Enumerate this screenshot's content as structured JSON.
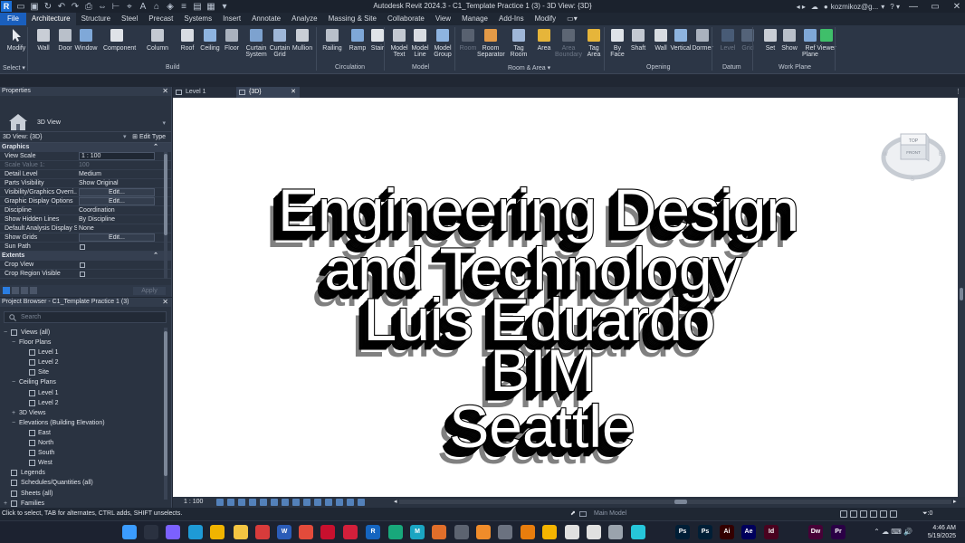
{
  "title_bar": {
    "app_title": "Autodesk Revit 2024.3 - C1_Template Practice 1 (3) - 3D View: {3D}",
    "user": "kozmikoz@g...",
    "help": "?"
  },
  "ribbon_tabs": [
    "File",
    "Architecture",
    "Structure",
    "Steel",
    "Precast",
    "Systems",
    "Insert",
    "Annotate",
    "Analyze",
    "Massing & Site",
    "Collaborate",
    "View",
    "Manage",
    "Add-Ins",
    "Modify"
  ],
  "active_tab": "Architecture",
  "ribbon": {
    "select_label": "Select",
    "tools": [
      {
        "label": "Modify",
        "icon": "modify-cursor-icon"
      },
      {
        "label": "Wall",
        "icon": "wall-icon"
      },
      {
        "label": "Door",
        "icon": "door-icon"
      },
      {
        "label": "Window",
        "icon": "window-icon"
      },
      {
        "label": "Component",
        "icon": "component-icon"
      },
      {
        "label": "Column",
        "icon": "column-icon"
      },
      {
        "label": "Roof",
        "icon": "roof-icon"
      },
      {
        "label": "Ceiling",
        "icon": "ceiling-icon"
      },
      {
        "label": "Floor",
        "icon": "floor-icon"
      },
      {
        "label": "Curtain\nSystem",
        "icon": "curtain-system-icon"
      },
      {
        "label": "Curtain\nGrid",
        "icon": "curtain-grid-icon"
      },
      {
        "label": "Mullion",
        "icon": "mullion-icon"
      },
      {
        "label": "Railing",
        "icon": "railing-icon"
      },
      {
        "label": "Ramp",
        "icon": "ramp-icon"
      },
      {
        "label": "Stair",
        "icon": "stair-icon"
      },
      {
        "label": "Model\nText",
        "icon": "model-text-icon"
      },
      {
        "label": "Model\nLine",
        "icon": "model-line-icon"
      },
      {
        "label": "Model\nGroup",
        "icon": "model-group-icon"
      },
      {
        "label": "Room",
        "icon": "room-icon"
      },
      {
        "label": "Room\nSeparator",
        "icon": "room-separator-icon"
      },
      {
        "label": "Tag\nRoom",
        "icon": "tag-room-icon"
      },
      {
        "label": "Area",
        "icon": "area-icon"
      },
      {
        "label": "Area\nBoundary",
        "icon": "area-boundary-icon"
      },
      {
        "label": "Tag\nArea",
        "icon": "tag-area-icon"
      },
      {
        "label": "By\nFace",
        "icon": "by-face-icon"
      },
      {
        "label": "Shaft",
        "icon": "shaft-icon"
      },
      {
        "label": "Wall",
        "icon": "opening-wall-icon"
      },
      {
        "label": "Vertical",
        "icon": "vertical-icon"
      },
      {
        "label": "Dormer",
        "icon": "dormer-icon"
      },
      {
        "label": "Level",
        "icon": "level-icon"
      },
      {
        "label": "Grid",
        "icon": "grid-icon"
      },
      {
        "label": "Set",
        "icon": "set-icon"
      },
      {
        "label": "Show",
        "icon": "show-icon"
      },
      {
        "label": "Ref\nPlane",
        "icon": "ref-plane-icon"
      },
      {
        "label": "Viewer",
        "icon": "viewer-icon"
      }
    ],
    "panels": [
      "Build",
      "Circulation",
      "Model",
      "Room & Area",
      "Opening",
      "Datum",
      "Work Plane"
    ]
  },
  "properties": {
    "title": "Properties",
    "type_name": "3D View",
    "view_selector": "3D View: {3D}",
    "edit_type": "Edit Type",
    "groups": [
      {
        "name": "Graphics",
        "rows": [
          {
            "name": "View Scale",
            "value": "1 : 100",
            "kind": "input"
          },
          {
            "name": "Scale Value    1:",
            "value": "100",
            "kind": "disabled"
          },
          {
            "name": "Detail Level",
            "value": "Medium",
            "kind": "text"
          },
          {
            "name": "Parts Visibility",
            "value": "Show Original",
            "kind": "text"
          },
          {
            "name": "Visibility/Graphics Overri...",
            "value": "Edit...",
            "kind": "button"
          },
          {
            "name": "Graphic Display Options",
            "value": "Edit...",
            "kind": "button"
          },
          {
            "name": "Discipline",
            "value": "Coordination",
            "kind": "text"
          },
          {
            "name": "Show Hidden Lines",
            "value": "By Discipline",
            "kind": "text"
          },
          {
            "name": "Default Analysis Display S...",
            "value": "None",
            "kind": "text"
          },
          {
            "name": "Show Grids",
            "value": "Edit...",
            "kind": "button"
          },
          {
            "name": "Sun Path",
            "value": "",
            "kind": "checkbox"
          }
        ]
      },
      {
        "name": "Extents",
        "rows": [
          {
            "name": "Crop View",
            "value": "",
            "kind": "checkbox"
          },
          {
            "name": "Crop Region Visible",
            "value": "",
            "kind": "checkbox"
          }
        ]
      }
    ],
    "apply": "Apply"
  },
  "project_browser": {
    "title": "Project Browser - C1_Template Practice 1 (3)",
    "search_placeholder": "Search",
    "nodes": [
      {
        "label": "Views (all)",
        "level": 0,
        "toggle": "−",
        "icon": "views-icon"
      },
      {
        "label": "Floor Plans",
        "level": 1,
        "toggle": "−",
        "icon": ""
      },
      {
        "label": "Level 1",
        "level": 2,
        "toggle": "",
        "icon": "view-icon"
      },
      {
        "label": "Level 2",
        "level": 2,
        "toggle": "",
        "icon": "view-icon"
      },
      {
        "label": "Site",
        "level": 2,
        "toggle": "",
        "icon": "view-icon"
      },
      {
        "label": "Ceiling Plans",
        "level": 1,
        "toggle": "−",
        "icon": ""
      },
      {
        "label": "Level 1",
        "level": 2,
        "toggle": "",
        "icon": "view-icon"
      },
      {
        "label": "Level 2",
        "level": 2,
        "toggle": "",
        "icon": "view-icon"
      },
      {
        "label": "3D Views",
        "level": 1,
        "toggle": "+",
        "icon": ""
      },
      {
        "label": "Elevations (Building Elevation)",
        "level": 1,
        "toggle": "−",
        "icon": ""
      },
      {
        "label": "East",
        "level": 2,
        "toggle": "",
        "icon": "view-icon"
      },
      {
        "label": "North",
        "level": 2,
        "toggle": "",
        "icon": "view-icon"
      },
      {
        "label": "South",
        "level": 2,
        "toggle": "",
        "icon": "view-icon"
      },
      {
        "label": "West",
        "level": 2,
        "toggle": "",
        "icon": "view-icon"
      },
      {
        "label": "Legends",
        "level": 0,
        "toggle": "",
        "icon": "legends-icon"
      },
      {
        "label": "Schedules/Quantities (all)",
        "level": 0,
        "toggle": "",
        "icon": "schedules-icon"
      },
      {
        "label": "Sheets (all)",
        "level": 0,
        "toggle": "",
        "icon": "sheets-icon"
      },
      {
        "label": "Families",
        "level": 0,
        "toggle": "+",
        "icon": "families-icon"
      }
    ]
  },
  "view_tabs": [
    {
      "label": "Level 1",
      "active": false
    },
    {
      "label": "{3D}",
      "active": true
    }
  ],
  "model_text": [
    "Engineering Design",
    "and Technology",
    "Luis Eduardo",
    "BIM",
    "Seattle"
  ],
  "viewcube": {
    "top": "TOP",
    "front": "FRONT"
  },
  "view_control_bar": {
    "scale": "1 : 100"
  },
  "status_bar": {
    "message": "Click to select, TAB for alternates, CTRL adds, SHIFT unselects.",
    "workset": "Main Model",
    "filter_count": ":0"
  },
  "taskbar": {
    "time": "4:46 AM",
    "date": "5/19/2025",
    "apps": [
      {
        "name": "windows-start",
        "text": "",
        "color": "#3b9cff"
      },
      {
        "name": "search",
        "text": "",
        "color": "#2a3140"
      },
      {
        "name": "copilot",
        "text": "",
        "color": "#7b61ff"
      },
      {
        "name": "edge",
        "text": "",
        "color": "#1e9ad6"
      },
      {
        "name": "chrome",
        "text": "",
        "color": "#f1b400"
      },
      {
        "name": "file-explorer",
        "text": "",
        "color": "#f4c542"
      },
      {
        "name": "app-red",
        "text": "",
        "color": "#d83b3b"
      },
      {
        "name": "word",
        "text": "W",
        "color": "#2b5cb8"
      },
      {
        "name": "app-2",
        "text": "",
        "color": "#e34b3b"
      },
      {
        "name": "autocad",
        "text": "",
        "color": "#c8102e"
      },
      {
        "name": "revit-a",
        "text": "",
        "color": "#d31f3b"
      },
      {
        "name": "revit",
        "text": "R",
        "color": "#1565c0"
      },
      {
        "name": "app-3",
        "text": "",
        "color": "#18a87b"
      },
      {
        "name": "app-m",
        "text": "M",
        "color": "#1aa5c2"
      },
      {
        "name": "app-4",
        "text": "",
        "color": "#e06e2a"
      },
      {
        "name": "app-5",
        "text": "",
        "color": "#5c6370"
      },
      {
        "name": "app-6",
        "text": "",
        "color": "#f08c2a"
      },
      {
        "name": "app-7",
        "text": "",
        "color": "#6b7280"
      },
      {
        "name": "blender",
        "text": "",
        "color": "#e87d0d"
      },
      {
        "name": "app-8",
        "text": "",
        "color": "#f4b400"
      },
      {
        "name": "app-9",
        "text": "",
        "color": "#e0e0e0"
      },
      {
        "name": "app-10",
        "text": "",
        "color": "#e0e0e0"
      },
      {
        "name": "app-11",
        "text": "",
        "color": "#9aa3ad"
      },
      {
        "name": "app-12",
        "text": "",
        "color": "#26c6da"
      },
      {
        "name": "photoshop",
        "text": "Ps",
        "color": "#001e36"
      },
      {
        "name": "premiere-rush",
        "text": "Ps",
        "color": "#001e36"
      },
      {
        "name": "illustrator",
        "text": "Ai",
        "color": "#330000"
      },
      {
        "name": "after-effects",
        "text": "Ae",
        "color": "#00005b"
      },
      {
        "name": "indesign",
        "text": "Id",
        "color": "#49021f"
      },
      {
        "name": "dreamweaver",
        "text": "Dw",
        "color": "#470137"
      },
      {
        "name": "premiere",
        "text": "Pr",
        "color": "#2a0045"
      }
    ]
  },
  "colors": {
    "accent": "#1a5fbd",
    "ribbon_bg": "#2c3646",
    "panel_bg": "#2a3341",
    "canvas_bg": "#ffffff",
    "text_shadow": "#808080"
  }
}
